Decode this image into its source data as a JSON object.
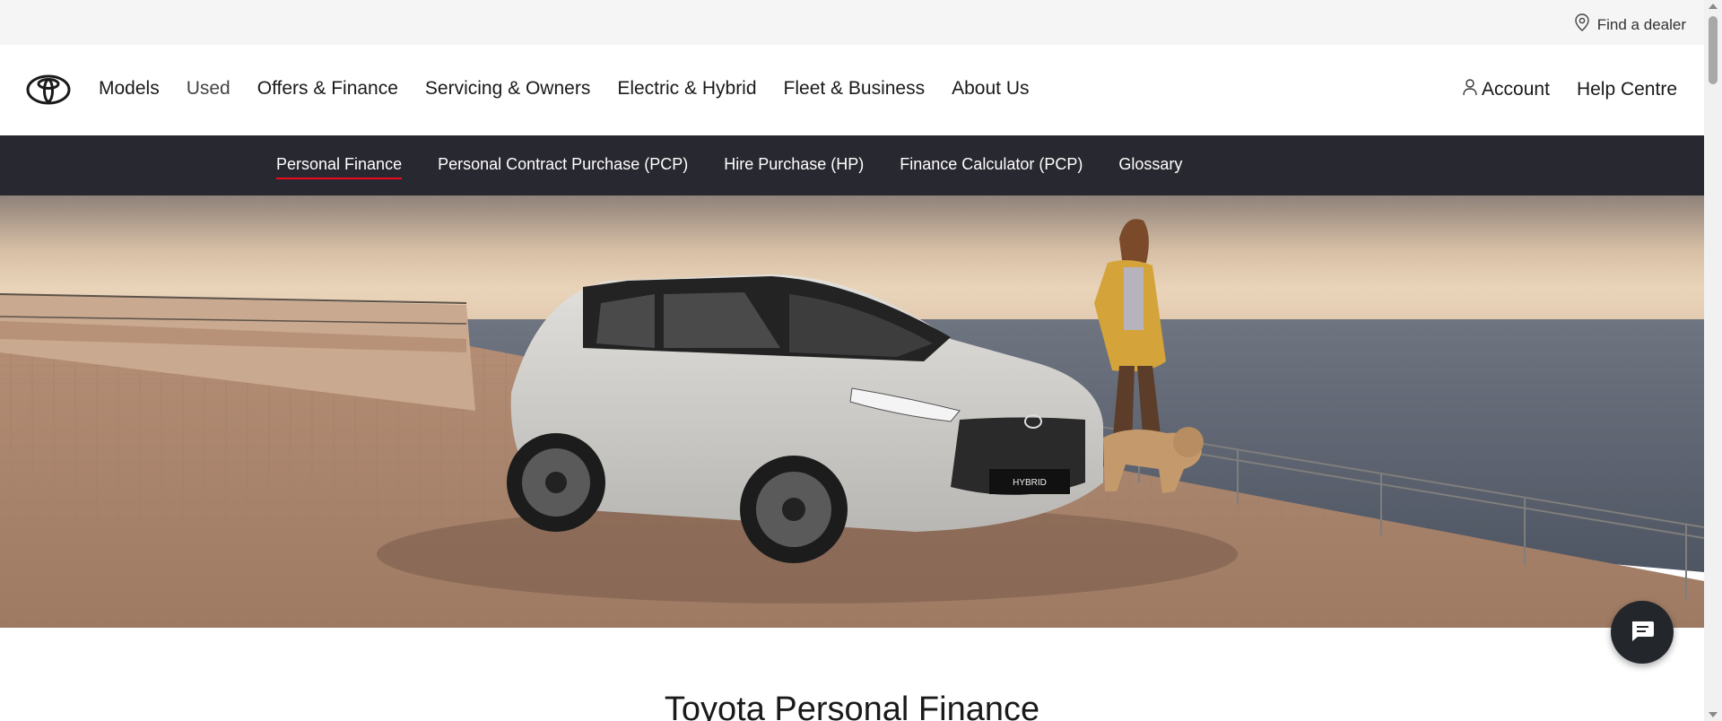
{
  "utility": {
    "find_dealer": "Find a dealer"
  },
  "nav": {
    "items": [
      "Models",
      "Used",
      "Offers & Finance",
      "Servicing & Owners",
      "Electric & Hybrid",
      "Fleet & Business",
      "About Us"
    ],
    "account": "Account",
    "help": "Help Centre"
  },
  "subnav": {
    "items": [
      "Personal Finance",
      "Personal Contract Purchase (PCP)",
      "Hire Purchase (HP)",
      "Finance Calculator (PCP)",
      "Glossary"
    ],
    "active_index": 0
  },
  "hero": {
    "car_badge": "HYBRID"
  },
  "page": {
    "heading": "Toyota Personal Finance"
  },
  "colors": {
    "brand_red": "#eb0a1e",
    "subnav_bg": "#282830",
    "utility_bg": "#f5f5f5"
  },
  "icons": {
    "find_dealer": "location-pin-icon",
    "account": "person-icon",
    "chat": "chat-bubble-icon"
  }
}
